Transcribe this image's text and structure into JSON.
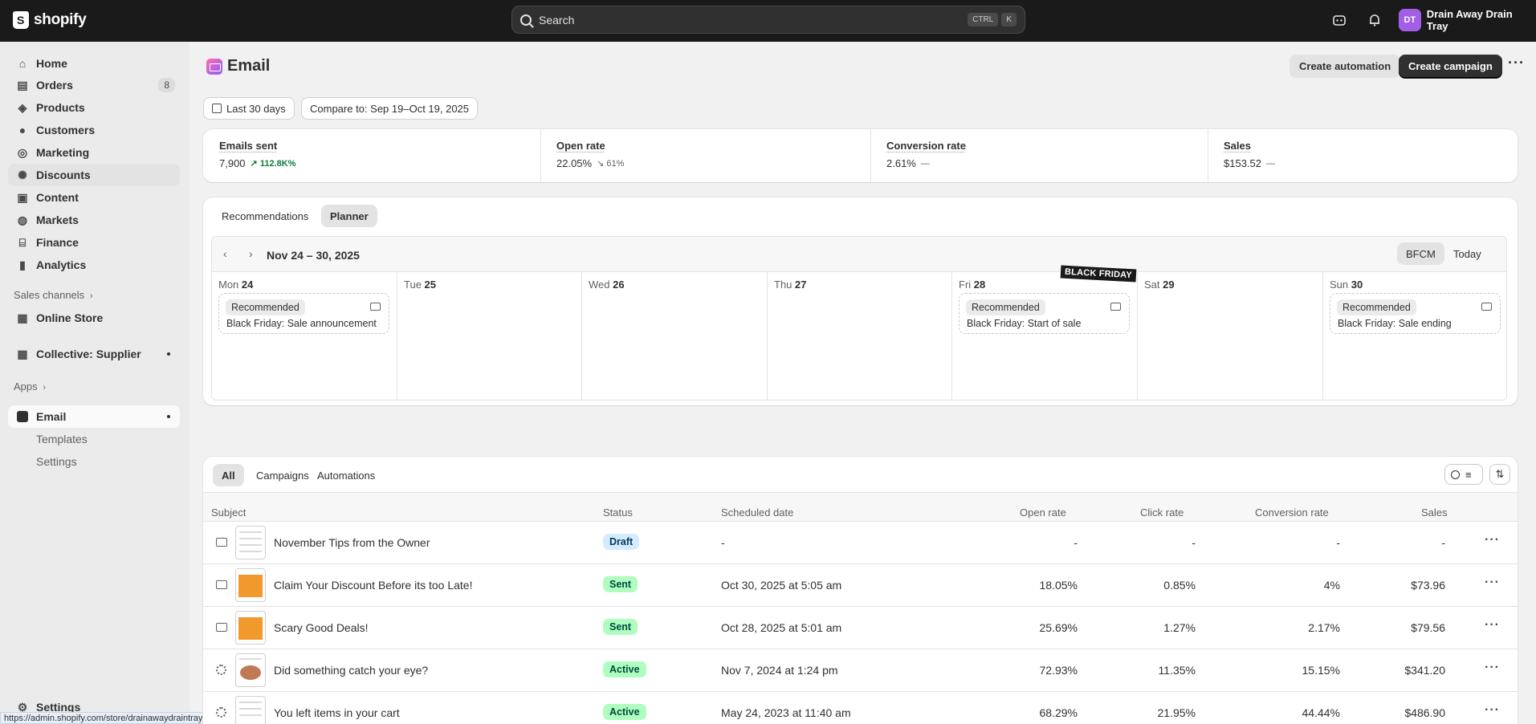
{
  "topbar": {
    "brand": "shopify",
    "search_placeholder": "Search",
    "shortcut_key_1": "CTRL",
    "shortcut_key_2": "K",
    "avatar_initials": "DT",
    "store_name": "Drain Away Drain Tray"
  },
  "sidebar": {
    "items": [
      {
        "label": "Home",
        "icon": "home-icon"
      },
      {
        "label": "Orders",
        "icon": "inbox-icon",
        "badge": "8"
      },
      {
        "label": "Products",
        "icon": "tag-icon"
      },
      {
        "label": "Customers",
        "icon": "person-icon"
      },
      {
        "label": "Marketing",
        "icon": "target-icon"
      },
      {
        "label": "Discounts",
        "icon": "discount-icon"
      },
      {
        "label": "Content",
        "icon": "content-icon"
      },
      {
        "label": "Markets",
        "icon": "globe-icon"
      },
      {
        "label": "Finance",
        "icon": "bank-icon"
      },
      {
        "label": "Analytics",
        "icon": "bar-chart-icon"
      }
    ],
    "sales_channels_label": "Sales channels",
    "online_store_label": "Online Store",
    "collective_label": "Collective: Supplier",
    "apps_label": "Apps",
    "email_label": "Email",
    "templates_label": "Templates",
    "app_settings_label": "Settings",
    "settings_label": "Settings",
    "status_url": "https://admin.shopify.com/store/drainawaydraintray/discounts"
  },
  "header": {
    "title": "Email",
    "create_automation": "Create automation",
    "create_campaign": "Create campaign"
  },
  "filters": {
    "date_range": "Last 30 days",
    "compare": "Compare to: Sep 19–Oct 19, 2025"
  },
  "metrics": [
    {
      "label": "Emails sent",
      "value": "7,900",
      "delta": "↗ 112.8K%"
    },
    {
      "label": "Open rate",
      "value": "22.05%",
      "delta": "↘ 61%"
    },
    {
      "label": "Conversion rate",
      "value": "2.61%",
      "delta": "—"
    },
    {
      "label": "Sales",
      "value": "$153.52",
      "delta": "—"
    }
  ],
  "planner": {
    "tabs": [
      "Recommendations",
      "Planner"
    ],
    "week_label": "Nov 24 – 30, 2025",
    "bfcm_button": "BFCM",
    "today_button": "Today",
    "black_friday_badge": "BLACK FRIDAY",
    "days": [
      {
        "dow": "Mon",
        "date": "24",
        "event": {
          "badge": "Recommended",
          "title": "Black Friday: Sale announcement"
        }
      },
      {
        "dow": "Tue",
        "date": "25"
      },
      {
        "dow": "Wed",
        "date": "26"
      },
      {
        "dow": "Thu",
        "date": "27"
      },
      {
        "dow": "Fri",
        "date": "28",
        "event": {
          "badge": "Recommended",
          "title": "Black Friday: Start of sale"
        }
      },
      {
        "dow": "Sat",
        "date": "29"
      },
      {
        "dow": "Sun",
        "date": "30",
        "event": {
          "badge": "Recommended",
          "title": "Black Friday: Sale ending"
        }
      }
    ]
  },
  "table": {
    "tabs": [
      "All",
      "Campaigns",
      "Automations"
    ],
    "columns": [
      "Subject",
      "Status",
      "Scheduled date",
      "Open rate",
      "Click rate",
      "Conversion rate",
      "Sales"
    ],
    "rows": [
      {
        "type": "campaign",
        "thumb": "plain",
        "subject": "November Tips from the Owner",
        "status": "Draft",
        "status_kind": "draft",
        "date": "-",
        "open": "-",
        "click": "-",
        "conv": "-",
        "sales": "-"
      },
      {
        "type": "campaign",
        "thumb": "orange",
        "subject": "Claim Your Discount Before its too Late!",
        "status": "Sent",
        "status_kind": "sent",
        "date": "Oct 30, 2025 at 5:05 am",
        "open": "18.05%",
        "click": "0.85%",
        "conv": "4%",
        "sales": "$73.96"
      },
      {
        "type": "campaign",
        "thumb": "orange",
        "subject": "Scary Good Deals!",
        "status": "Sent",
        "status_kind": "sent",
        "date": "Oct 28, 2025 at 5:01 am",
        "open": "25.69%",
        "click": "1.27%",
        "conv": "2.17%",
        "sales": "$79.56"
      },
      {
        "type": "automation",
        "thumb": "disc",
        "subject": "Did something catch your eye?",
        "status": "Active",
        "status_kind": "active",
        "date": "Nov 7, 2024 at 1:24 pm",
        "open": "72.93%",
        "click": "11.35%",
        "conv": "15.15%",
        "sales": "$341.20"
      },
      {
        "type": "automation",
        "thumb": "plain",
        "subject": "You left items in your cart",
        "status": "Active",
        "status_kind": "active",
        "date": "May 24, 2023 at 11:40 am",
        "open": "68.29%",
        "click": "21.95%",
        "conv": "44.44%",
        "sales": "$486.90"
      }
    ]
  }
}
